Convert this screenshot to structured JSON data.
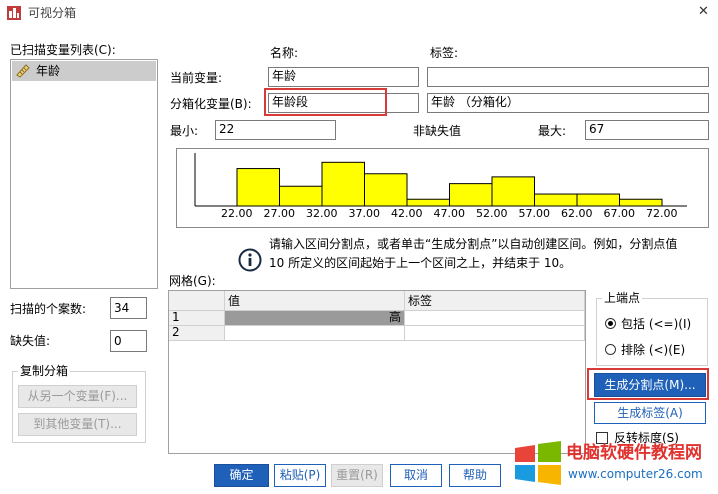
{
  "window": {
    "title": "可视分箱",
    "close_glyph": "✕"
  },
  "scanned_list": {
    "label": "已扫描变量列表(C):",
    "items": [
      "年龄"
    ]
  },
  "headers": {
    "name": "名称:",
    "label": "标签:"
  },
  "current_variable": {
    "label": "当前变量:",
    "name": "年龄",
    "var_label": ""
  },
  "binned_variable": {
    "label": "分箱化变量(B):",
    "name": "年龄段",
    "var_label": "年龄 （分箱化）"
  },
  "stats": {
    "min_label": "最小:",
    "min_value": "22",
    "nonmissing_label": "非缺失值",
    "max_label": "最大:",
    "max_value": "67"
  },
  "histogram": {
    "ticks": [
      "22.00",
      "27.00",
      "32.00",
      "37.00",
      "42.00",
      "47.00",
      "52.00",
      "57.00",
      "62.00",
      "67.00",
      "72.00"
    ],
    "bars": [
      {
        "from": 22,
        "to": 27,
        "level": 0.72
      },
      {
        "from": 27,
        "to": 32,
        "level": 0.38
      },
      {
        "from": 32,
        "to": 37,
        "level": 0.84
      },
      {
        "from": 37,
        "to": 42,
        "level": 0.62
      },
      {
        "from": 42,
        "to": 47,
        "level": 0.13
      },
      {
        "from": 47,
        "to": 52,
        "level": 0.43
      },
      {
        "from": 52,
        "to": 57,
        "level": 0.56
      },
      {
        "from": 57,
        "to": 62,
        "level": 0.23
      },
      {
        "from": 62,
        "to": 67,
        "level": 0.23
      },
      {
        "from": 67,
        "to": 72,
        "level": 0.13
      }
    ],
    "range": [
      22,
      72
    ],
    "bar_color": "#ffff00"
  },
  "info": {
    "line1": "请输入区间分割点，或者单击“生成分割点”以自动创建区间。例如，分割点值",
    "line2": "10 所定义的区间起始于上一个区间之上，并结束于 10。"
  },
  "grid": {
    "label": "网格(G):",
    "col_value": "值",
    "col_label": "标签",
    "rows": [
      {
        "num": "1",
        "value": "高",
        "label": ""
      },
      {
        "num": "2",
        "value": "",
        "label": ""
      }
    ]
  },
  "scan_info": {
    "cases_label": "扫描的个案数:",
    "cases_value": "34",
    "missing_label": "缺失值:",
    "missing_value": "0"
  },
  "copy_bins": {
    "title": "复制分箱",
    "from_label": "从另一个变量(F)...",
    "to_label": "到其他变量(T)..."
  },
  "upper_endpoint": {
    "title": "上端点",
    "include_label": "包括 (<=)(I)",
    "exclude_label": "排除 (<)(E)"
  },
  "actions": {
    "make_cutpoints": "生成分割点(M)...",
    "make_labels": "生成标签(A)",
    "reverse_scale": "反转标度(S)"
  },
  "footer": {
    "ok": "确定",
    "paste": "粘贴(P)",
    "reset": "重置(R)",
    "cancel": "取消",
    "help": "帮助"
  },
  "watermark": {
    "text1": "电脑软硬件教程网",
    "text2": "www.computer26.com"
  },
  "colors": {
    "accent": "#1f60b8",
    "highlight": "#d83a3a"
  }
}
